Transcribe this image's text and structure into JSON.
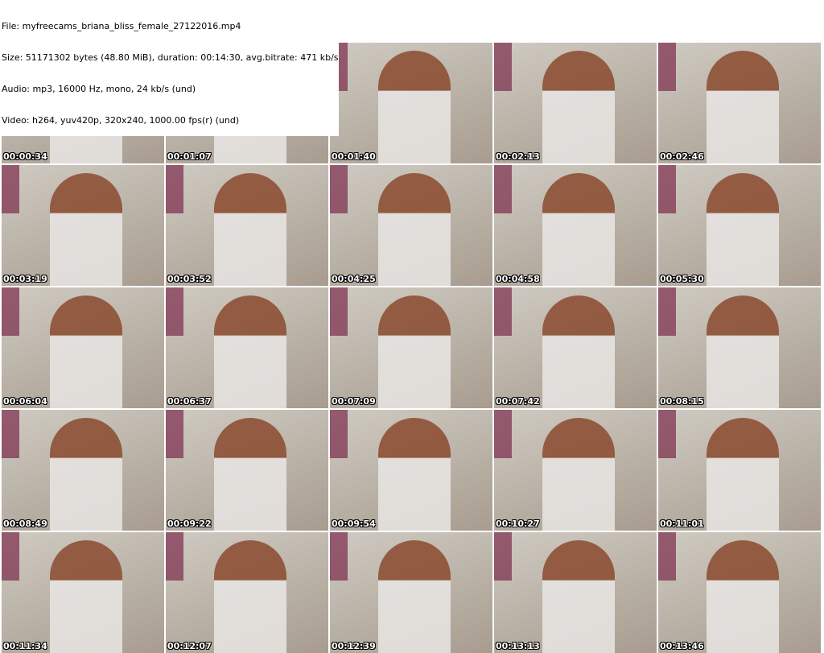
{
  "info": {
    "file": "File: myfreecams_briana_bliss_female_27122016.mp4",
    "size": "Size: 51171302 bytes (48.80 MiB), duration: 00:14:30, avg.bitrate: 471 kb/s",
    "audio": "Audio: mp3, 16000 Hz, mono, 24 kb/s (und)",
    "video": "Video: h264, yuv420p, 320x240, 1000.00 fps(r) (und)"
  },
  "thumbnails": [
    "00:00:34",
    "00:01:07",
    "00:01:40",
    "00:02:13",
    "00:02:46",
    "00:03:19",
    "00:03:52",
    "00:04:25",
    "00:04:58",
    "00:05:30",
    "00:06:04",
    "00:06:37",
    "00:07:09",
    "00:07:42",
    "00:08:15",
    "00:08:49",
    "00:09:22",
    "00:09:54",
    "00:10:27",
    "00:11:01",
    "00:11:34",
    "00:12:07",
    "00:12:39",
    "00:13:13",
    "00:13:46"
  ]
}
